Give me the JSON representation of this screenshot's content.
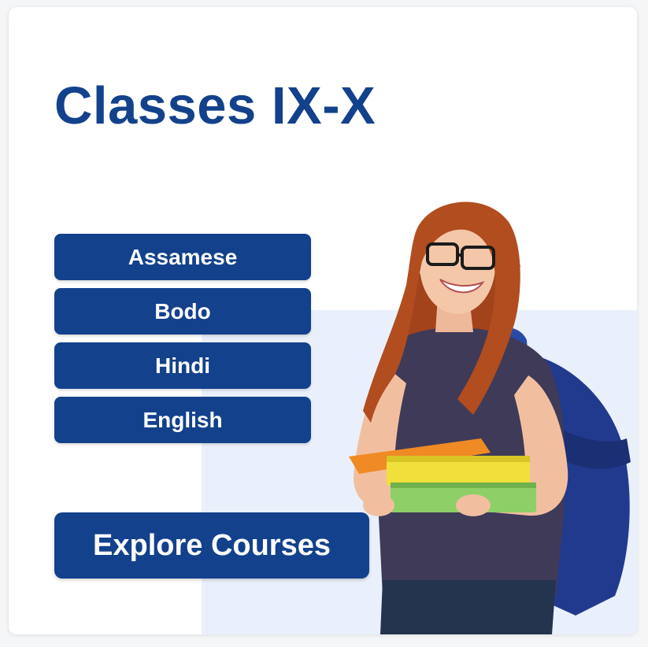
{
  "card": {
    "title": "Classes IX-X",
    "subjects": [
      "Assamese",
      "Bodo",
      "Hindi",
      "English"
    ],
    "cta_label": "Explore Courses"
  },
  "colors": {
    "brand_blue": "#13418c",
    "panel_light_blue": "#e9f0fb",
    "card_bg": "#ffffff"
  },
  "image": {
    "subject": "student-with-books-and-backpack"
  }
}
